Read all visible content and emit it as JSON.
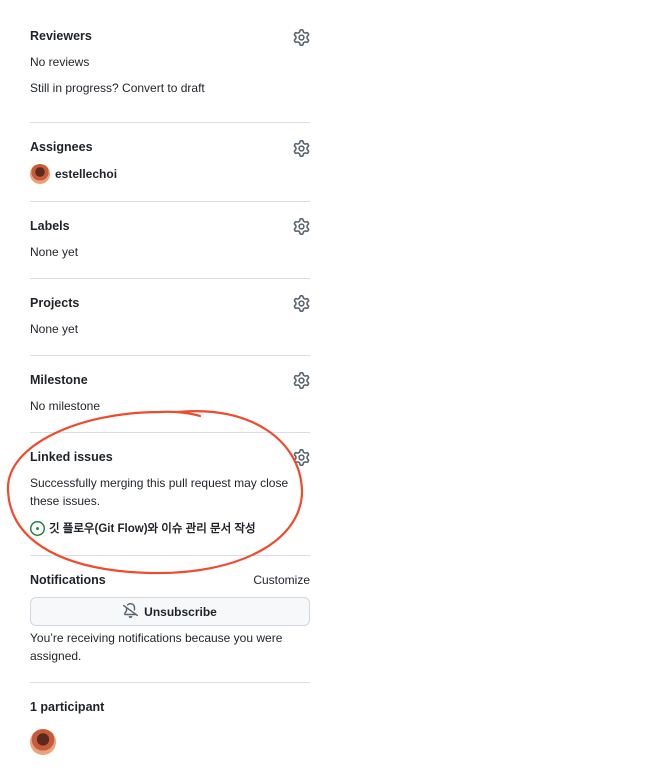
{
  "reviewers": {
    "title": "Reviewers",
    "status": "No reviews",
    "draft_link": "Still in progress? Convert to draft"
  },
  "assignees": {
    "title": "Assignees",
    "user": "estellechoi"
  },
  "labels": {
    "title": "Labels",
    "value": "None yet"
  },
  "projects": {
    "title": "Projects",
    "value": "None yet"
  },
  "milestone": {
    "title": "Milestone",
    "value": "No milestone"
  },
  "linked_issues": {
    "title": "Linked issues",
    "description": "Successfully merging this pull request may close these issues.",
    "issue_title": "깃 플로우(Git Flow)와 이슈 관리 문서 작성",
    "issue_icon": "issue-opened-icon",
    "issue_icon_color": "#1a7f37"
  },
  "notifications": {
    "title": "Notifications",
    "customize": "Customize",
    "button": "Unsubscribe",
    "reason": "You’re receiving notifications because you were assigned."
  },
  "participants": {
    "title": "1 participant"
  },
  "annotation": {
    "color": "#f04a2a"
  }
}
